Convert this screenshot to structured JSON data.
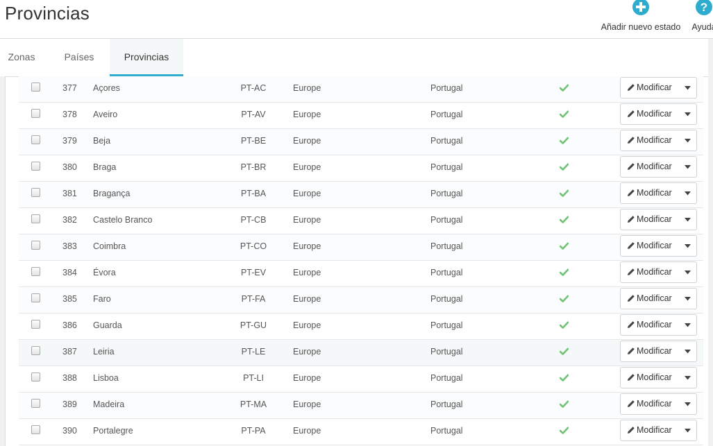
{
  "header": {
    "title": "Provincias",
    "add_label": "Añadir nuevo estado",
    "add_icon": "plus-circle-icon",
    "help_label": "Ayuda",
    "help_icon": "question-circle-icon",
    "accent": "#2eacce"
  },
  "tabs": [
    {
      "label": "Zonas"
    },
    {
      "label": "Países"
    },
    {
      "label": "Provincias",
      "active": true
    }
  ],
  "colors": {
    "enabled_check": "#72c279",
    "active_tab": "#2eacce"
  },
  "table": {
    "rows": [
      {
        "id": "377",
        "name": "Açores",
        "iso": "PT-AC",
        "zone": "Europe",
        "country": "Portugal",
        "action": "Modificar"
      },
      {
        "id": "378",
        "name": "Aveiro",
        "iso": "PT-AV",
        "zone": "Europe",
        "country": "Portugal",
        "action": "Modificar"
      },
      {
        "id": "379",
        "name": "Beja",
        "iso": "PT-BE",
        "zone": "Europe",
        "country": "Portugal",
        "action": "Modificar"
      },
      {
        "id": "380",
        "name": "Braga",
        "iso": "PT-BR",
        "zone": "Europe",
        "country": "Portugal",
        "action": "Modificar"
      },
      {
        "id": "381",
        "name": "Bragança",
        "iso": "PT-BA",
        "zone": "Europe",
        "country": "Portugal",
        "action": "Modificar"
      },
      {
        "id": "382",
        "name": "Castelo Branco",
        "iso": "PT-CB",
        "zone": "Europe",
        "country": "Portugal",
        "action": "Modificar"
      },
      {
        "id": "383",
        "name": "Coimbra",
        "iso": "PT-CO",
        "zone": "Europe",
        "country": "Portugal",
        "action": "Modificar"
      },
      {
        "id": "384",
        "name": "Évora",
        "iso": "PT-EV",
        "zone": "Europe",
        "country": "Portugal",
        "action": "Modificar"
      },
      {
        "id": "385",
        "name": "Faro",
        "iso": "PT-FA",
        "zone": "Europe",
        "country": "Portugal",
        "action": "Modificar"
      },
      {
        "id": "386",
        "name": "Guarda",
        "iso": "PT-GU",
        "zone": "Europe",
        "country": "Portugal",
        "action": "Modificar"
      },
      {
        "id": "387",
        "name": "Leiria",
        "iso": "PT-LE",
        "zone": "Europe",
        "country": "Portugal",
        "action": "Modificar"
      },
      {
        "id": "388",
        "name": "Lisboa",
        "iso": "PT-LI",
        "zone": "Europe",
        "country": "Portugal",
        "action": "Modificar"
      },
      {
        "id": "389",
        "name": "Madeira",
        "iso": "PT-MA",
        "zone": "Europe",
        "country": "Portugal",
        "action": "Modificar"
      },
      {
        "id": "390",
        "name": "Portalegre",
        "iso": "PT-PA",
        "zone": "Europe",
        "country": "Portugal",
        "action": "Modificar"
      }
    ]
  }
}
